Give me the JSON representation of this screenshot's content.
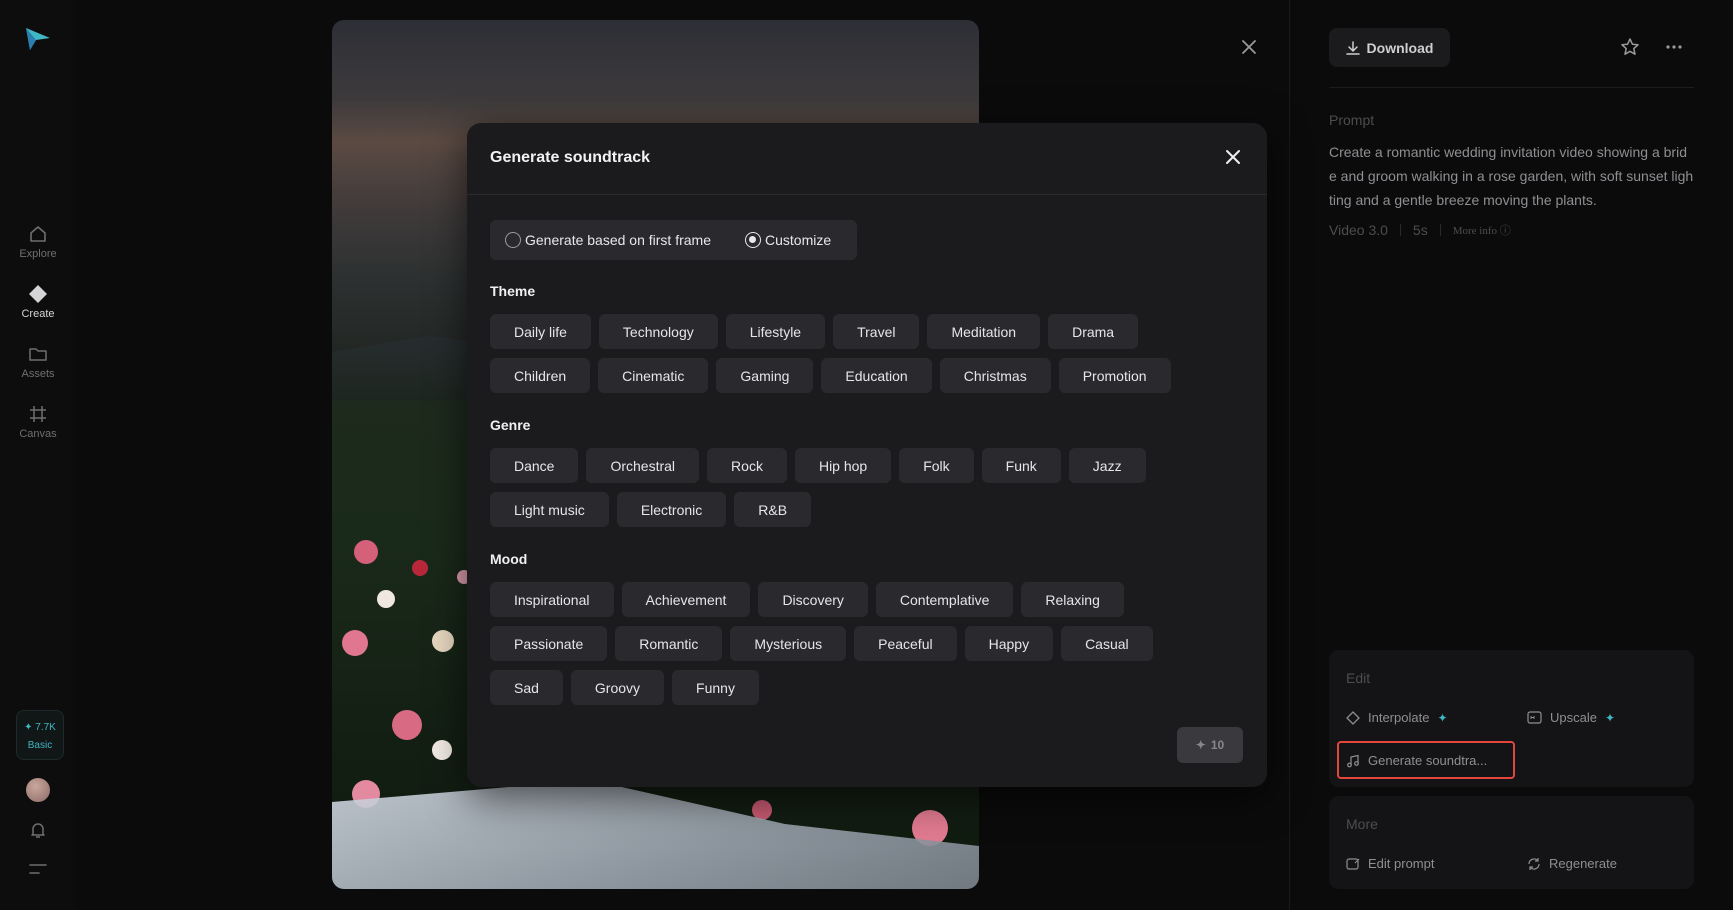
{
  "sidebar": {
    "items": [
      {
        "label": "Explore",
        "icon": "home-icon"
      },
      {
        "label": "Create",
        "icon": "diamond-icon"
      },
      {
        "label": "Assets",
        "icon": "folder-icon"
      },
      {
        "label": "Canvas",
        "icon": "frame-icon"
      }
    ],
    "credits_value": "✦ 7.7K",
    "credits_plan": "Basic"
  },
  "right_panel": {
    "download_label": "Download",
    "prompt_label": "Prompt",
    "prompt_text": "Create a romantic wedding invitation video showing a bride and groom walking in a rose garden, with soft sunset lighting and a gentle breeze moving the plants.",
    "meta_model": "Video 3.0",
    "meta_duration": "5s",
    "meta_more": "More info",
    "edit_label": "Edit",
    "interpolate_label": "Interpolate",
    "upscale_label": "Upscale",
    "generate_soundtrack_label": "Generate soundtra...",
    "more_label": "More",
    "edit_prompt_label": "Edit prompt",
    "regenerate_label": "Regenerate"
  },
  "modal": {
    "title": "Generate soundtrack",
    "option_first_frame": "Generate based on first frame",
    "option_customize": "Customize",
    "selected_option": "Customize",
    "theme_label": "Theme",
    "theme_rows": [
      [
        "Daily life",
        "Technology",
        "Lifestyle",
        "Travel",
        "Meditation",
        "Drama"
      ],
      [
        "Children",
        "Cinematic",
        "Gaming",
        "Education",
        "Christmas",
        "Promotion"
      ]
    ],
    "genre_label": "Genre",
    "genre_rows": [
      [
        "Dance",
        "Orchestral",
        "Rock",
        "Hip hop",
        "Folk",
        "Funk",
        "Jazz"
      ],
      [
        "Light music",
        "Electronic",
        "R&B"
      ]
    ],
    "mood_label": "Mood",
    "mood_rows": [
      [
        "Inspirational",
        "Achievement",
        "Discovery",
        "Contemplative",
        "Relaxing"
      ],
      [
        "Passionate",
        "Romantic",
        "Mysterious",
        "Peaceful",
        "Happy",
        "Casual"
      ],
      [
        "Sad",
        "Groovy",
        "Funny"
      ]
    ],
    "cost": "10"
  },
  "colors": {
    "accent": "#3fb7c5",
    "highlight": "#e2463d"
  }
}
